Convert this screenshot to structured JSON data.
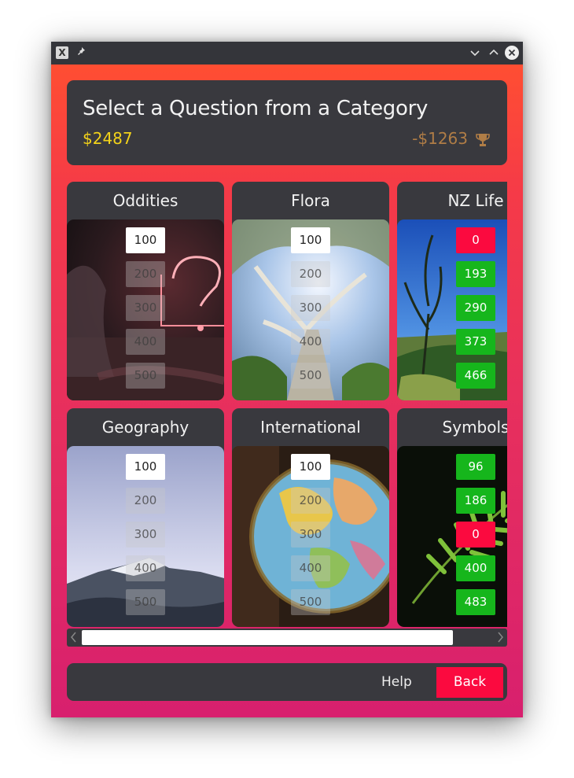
{
  "window": {
    "app_icon": "X"
  },
  "header": {
    "title": "Select a Question from a Category",
    "score": "$2487",
    "opponent_score": "-$1263",
    "trophy_icon": "trophy-icon"
  },
  "categories": [
    {
      "name": "Oddities",
      "questions": [
        {
          "label": "100",
          "state": "active"
        },
        {
          "label": "200",
          "state": "used"
        },
        {
          "label": "300",
          "state": "used"
        },
        {
          "label": "400",
          "state": "used"
        },
        {
          "label": "500",
          "state": "used"
        }
      ]
    },
    {
      "name": "Flora",
      "questions": [
        {
          "label": "100",
          "state": "active"
        },
        {
          "label": "200",
          "state": "used"
        },
        {
          "label": "300",
          "state": "used"
        },
        {
          "label": "400",
          "state": "used"
        },
        {
          "label": "500",
          "state": "used"
        }
      ]
    },
    {
      "name": "NZ Life",
      "questions": [
        {
          "label": "0",
          "state": "wrong"
        },
        {
          "label": "193",
          "state": "correct"
        },
        {
          "label": "290",
          "state": "correct"
        },
        {
          "label": "373",
          "state": "correct"
        },
        {
          "label": "466",
          "state": "correct"
        }
      ]
    },
    {
      "name": "Geography",
      "questions": [
        {
          "label": "100",
          "state": "active"
        },
        {
          "label": "200",
          "state": "used"
        },
        {
          "label": "300",
          "state": "used"
        },
        {
          "label": "400",
          "state": "used"
        },
        {
          "label": "500",
          "state": "used"
        }
      ]
    },
    {
      "name": "International",
      "questions": [
        {
          "label": "100",
          "state": "active"
        },
        {
          "label": "200",
          "state": "used"
        },
        {
          "label": "300",
          "state": "used"
        },
        {
          "label": "400",
          "state": "used"
        },
        {
          "label": "500",
          "state": "used"
        }
      ]
    },
    {
      "name": "Symbols",
      "questions": [
        {
          "label": "96",
          "state": "correct"
        },
        {
          "label": "186",
          "state": "correct"
        },
        {
          "label": "0",
          "state": "wrong"
        },
        {
          "label": "400",
          "state": "correct"
        },
        {
          "label": "483",
          "state": "correct"
        }
      ]
    }
  ],
  "footer": {
    "help_label": "Help",
    "back_label": "Back"
  },
  "colors": {
    "accent_red": "#fb0a3f",
    "correct_green": "#16b61c",
    "score_yellow": "#f2d21a",
    "panel": "#39393e"
  }
}
